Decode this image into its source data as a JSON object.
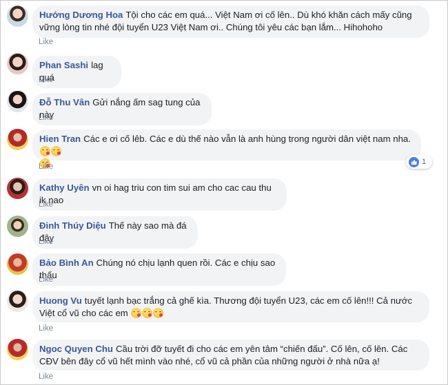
{
  "like_label": "Like",
  "comments": [
    {
      "name": "Hướng Dương Hoa",
      "text": "Tội cho các em quá... Việt Nam ơi cố lên.. Dù khó khăn cách mấy cũng vững lòng tin nhé đội tuyển U23 Việt Nam ơi.. Chúng tôi yêu các bạn lắm... Hihohoho",
      "emoji_count": 0
    },
    {
      "name": "Phan Sashi",
      "text": "lag quá",
      "emoji_count": 0
    },
    {
      "name": "Đỗ Thu Vân",
      "text": "Gửi nắng ấm sag tung của này",
      "emoji_count": 0
    },
    {
      "name": "Hien Tran",
      "text": "Các e ơi cố lêb. Các e dù thế nào vẫn là anh hùng trong người dân việt nam nha.",
      "emoji_count": 3,
      "reactions": "1"
    },
    {
      "name": "Kathy Uyên",
      "text": "vn oi hag triu con tim sui am cho cac cau thu ik nao",
      "emoji_count": 0
    },
    {
      "name": "Đinh Thúy Diệu",
      "text": "Thế này sao mà đá đây",
      "emoji_count": 0
    },
    {
      "name": "Bảo Bình An",
      "text": "Chúng nó chịu lạnh quen rồi. Các e chịu sao thấu",
      "emoji_count": 0
    },
    {
      "name": "Huong Vu",
      "text": "tuyết lạnh bạc trắng cả ghế kìa. Thương đội tuyển U23, các em cố lên!!! Cả nước Việt cổ vũ cho các em",
      "emoji_count": 3
    },
    {
      "name": "Ngoc Quyen Chu",
      "text": "Cầu trời đỡ tuyết đi cho các em yên tâm “chiến đấu”. Cố lên, cố lên. Các CĐV bên đây cổ vũ hết mình vào nhé, cổ vũ cả phần của những người ở nhà nữa ạ!",
      "emoji_count": 0
    }
  ],
  "colors": {
    "name": "#385898",
    "bubble": "#f2f3f5",
    "like": "#7a8594",
    "reaction": "#4a7de2"
  }
}
